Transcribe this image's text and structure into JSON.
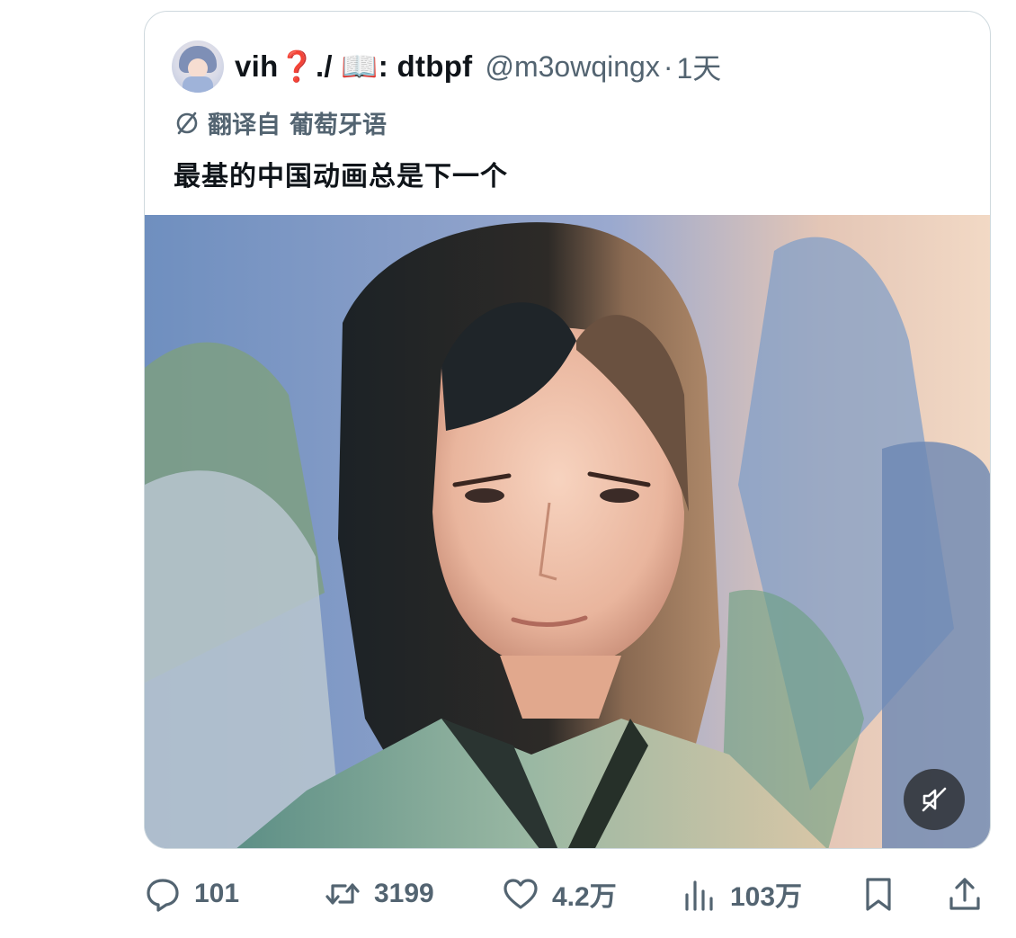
{
  "tweet": {
    "display_name": "vih❓./ 📖: dtbpf",
    "handle": "@m3owqingx",
    "separator": "·",
    "time": "1天",
    "translated_from_label": "翻译自",
    "translated_language": "葡萄牙语",
    "text": "最基的中国动画总是下一个"
  },
  "actions": {
    "reply_count": "101",
    "retweet_count": "3199",
    "like_count": "4.2万",
    "views_count": "103万"
  },
  "icons": {
    "avatar": "avatar-image",
    "translate": "translate-icon",
    "mute": "speaker-muted-icon",
    "reply": "reply-icon",
    "retweet": "retweet-icon",
    "like": "heart-icon",
    "views": "bar-chart-icon",
    "bookmark": "bookmark-icon",
    "share": "share-icon"
  },
  "colors": {
    "secondary_text": "#536471",
    "primary_text": "#0f1419",
    "border": "#cfd9de"
  }
}
